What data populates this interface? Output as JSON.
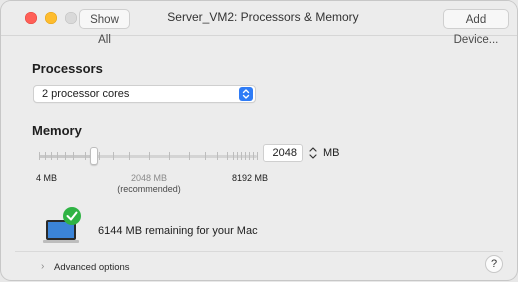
{
  "window": {
    "title": "Server_VM2: Processors & Memory",
    "show_all_label": "Show All",
    "add_device_label": "Add Device..."
  },
  "processors": {
    "heading": "Processors",
    "selected": "2  processor cores"
  },
  "memory": {
    "heading": "Memory",
    "value": "2048",
    "unit": "MB",
    "min_label": "4 MB",
    "recommended_value_label": "2048 MB",
    "recommended_note": "(recommended)",
    "max_label": "8192 MB",
    "slider_fraction": 0.25
  },
  "status": {
    "remaining_text": "6144 MB remaining for your Mac",
    "check_color": "#2fb344"
  },
  "footer": {
    "advanced_label": "Advanced options",
    "help_label": "?"
  },
  "colors": {
    "accent": "#2f7cf6",
    "red": "#ff5f57",
    "yellow": "#febc2e"
  }
}
